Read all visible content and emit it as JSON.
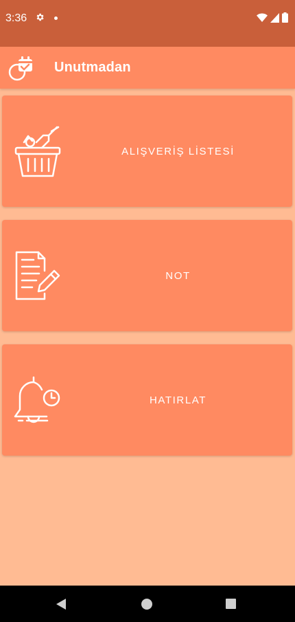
{
  "status_bar": {
    "time": "3:36",
    "icons": [
      "settings-icon",
      "notification-dot",
      "wifi-icon",
      "signal-icon",
      "battery-icon"
    ]
  },
  "app_bar": {
    "title": "Unutmadan",
    "logo_icon": "calendar-check-icon"
  },
  "cards": [
    {
      "label": "ALIŞVERİŞ LİSTESİ",
      "icon": "shopping-basket-icon"
    },
    {
      "label": "NOT",
      "icon": "note-pencil-icon"
    },
    {
      "label": "HATIRLAT",
      "icon": "bell-clock-icon"
    }
  ],
  "nav_bar": {
    "buttons": [
      "back-icon",
      "home-icon",
      "recents-icon"
    ]
  },
  "colors": {
    "status_bar": "#c95f3a",
    "app_bar": "#ff8a61",
    "card": "#ff8a61",
    "background": "#ffbb93",
    "text": "#ffffff"
  }
}
